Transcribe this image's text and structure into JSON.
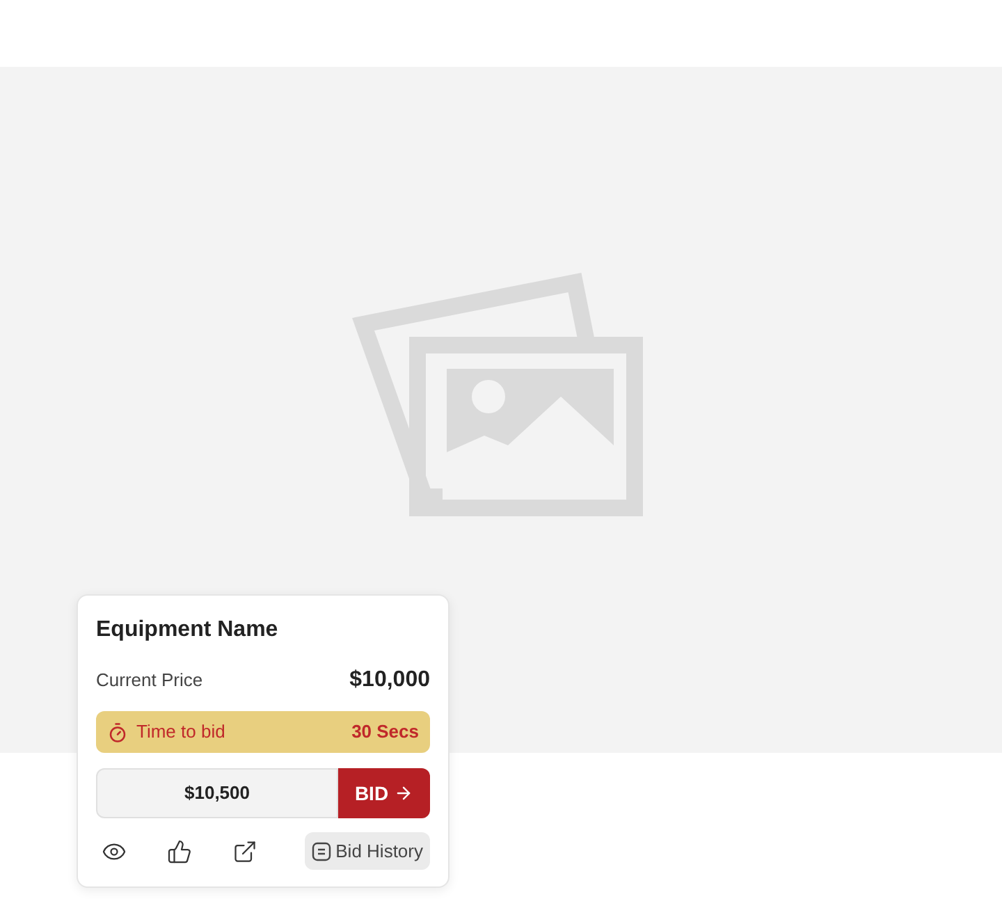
{
  "card": {
    "title": "Equipment Name",
    "price_label": "Current Price",
    "price": "$10,000",
    "timer": {
      "label": "Time to bid",
      "value": "30 Secs"
    },
    "bid": {
      "amount": "$10,500",
      "button": "BID"
    },
    "actions": {
      "history": "Bid History"
    }
  }
}
